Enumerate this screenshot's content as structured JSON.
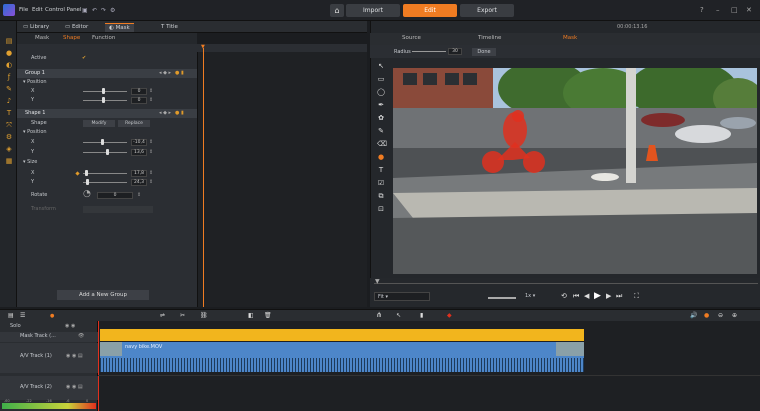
{
  "menu": {
    "file": "File",
    "edit": "Edit",
    "control_panel": "Control Panel"
  },
  "modes": {
    "import": "Import",
    "edit": "Edit",
    "export": "Export"
  },
  "colors": {
    "accent": "#f07c22",
    "mask_red": "#e0301e",
    "clip_yellow": "#f2b51d",
    "clip_blue": "#4d86c9"
  },
  "library_tabs": {
    "library": "Library",
    "editor": "Editor",
    "mask": "Mask",
    "title": "Title"
  },
  "sub_tabs": {
    "mask": "Mask",
    "shape": "Shape",
    "function": "Function"
  },
  "props": {
    "active": "Active",
    "group1": "Group 1",
    "position": "Position",
    "x": "X",
    "y": "Y",
    "shape1": "Shape 1",
    "shape": "Shape",
    "modify": "Modify",
    "replace": "Replace",
    "size": "Size",
    "rotate": "Rotate",
    "transform": "Transform",
    "g_pos_x": "0",
    "g_pos_y": "0",
    "s_pos_x": "-10,4",
    "s_pos_y": "13,6",
    "size_x": "17,8",
    "size_y": "24,3",
    "rot": "0",
    "add_group": "Add a New Group"
  },
  "timecode_top": "00:00:13.16",
  "right_tabs": {
    "source": "Source",
    "timeline": "Timeline",
    "mask": "Mask"
  },
  "radius": {
    "label": "Radius",
    "value": "30",
    "done": "Done"
  },
  "fit": "Fit",
  "speed": "1x",
  "timeline": {
    "solo": "Solo",
    "mask_track": "Mask Track (...",
    "av1": "A/V Track (1)",
    "av2": "A/V Track (2)",
    "clip_name": "navy bike.MOV",
    "db_levels": [
      "-60",
      "-22",
      "-16",
      "-6",
      "0"
    ]
  }
}
